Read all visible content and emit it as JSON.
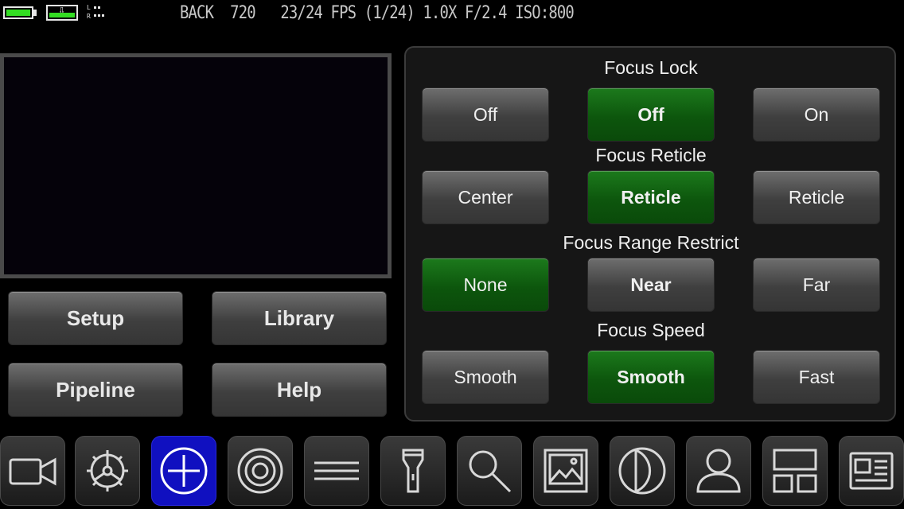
{
  "status": {
    "text": "BACK  720   23/24 FPS (1/24) 1.0X F/2.4 ISO:800",
    "battery_color": "#33dd22",
    "audio_left": "L",
    "audio_right": "R"
  },
  "buttons": {
    "setup": "Setup",
    "library": "Library",
    "pipeline": "Pipeline",
    "help": "Help"
  },
  "focus_lock": {
    "heading": "Focus Lock",
    "options": [
      "Off",
      "Off",
      "On"
    ]
  },
  "focus_reticle": {
    "heading": "Focus Reticle",
    "options": [
      "Center",
      "Reticle",
      "Reticle"
    ]
  },
  "focus_range": {
    "heading": "Focus Range Restrict",
    "options": [
      "None",
      "Near",
      "Far"
    ]
  },
  "focus_speed": {
    "heading": "Focus Speed",
    "options": [
      "Smooth",
      "Smooth",
      "Fast"
    ]
  },
  "toolbar": {
    "icons": [
      "video-camera-icon",
      "gear-icon",
      "crosshair-icon",
      "target-icon",
      "menu-lines-icon",
      "flashlight-icon",
      "magnifier-icon",
      "image-icon",
      "contrast-icon",
      "person-icon",
      "layout-icon",
      "news-icon"
    ],
    "active": "crosshair-icon",
    "active_color": "#1010c0"
  },
  "colors": {
    "selected_green": "#0d560d"
  }
}
